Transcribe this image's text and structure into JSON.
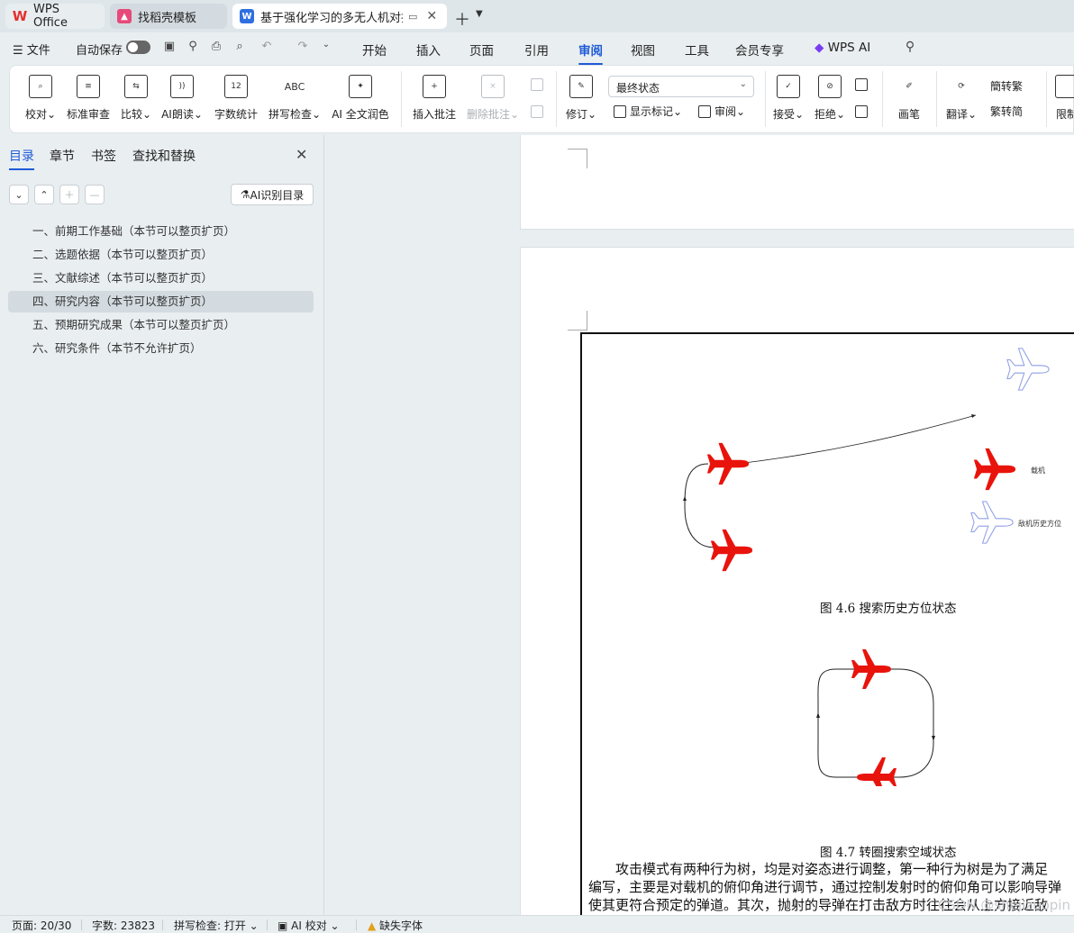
{
  "tabs": {
    "wps": "WPS Office",
    "templates": "找稻壳模板",
    "document": "基于强化学习的多无人机对抗"
  },
  "menu": {
    "file": "文件",
    "autosave": "自动保存",
    "tabs": [
      "开始",
      "插入",
      "页面",
      "引用",
      "审阅",
      "视图",
      "工具",
      "会员专享"
    ],
    "active_tab": "审阅",
    "wps_ai": "WPS AI"
  },
  "ribbon": {
    "proofread": "校对",
    "standard_review": "标准审查",
    "compare": "比较",
    "ai_read": "AI朗读",
    "word_count": "字数统计",
    "spell_check": "拼写检查",
    "ai_polish": "AI 全文润色",
    "insert_comment": "插入批注",
    "delete_comment": "删除批注",
    "revise": "修订",
    "final_state": "最终状态",
    "show_markup": "显示标记",
    "review": "审阅",
    "accept": "接受",
    "reject": "拒绝",
    "pen": "画笔",
    "translate": "翻译",
    "trad_conv": "转繁",
    "simp_conv": "转简",
    "restrict": "限制",
    "abc": "ABC",
    "num12": "12"
  },
  "sidebar": {
    "tabs": [
      "目录",
      "章节",
      "书签",
      "查找和替换"
    ],
    "active_tab": "目录",
    "ai_toc": "AI识别目录",
    "toc_items": [
      "一、前期工作基础（本节可以整页扩页）",
      "二、选题依据（本节可以整页扩页）",
      "三、文献综述（本节可以整页扩页）",
      "四、研究内容（本节可以整页扩页）",
      "五、预期研究成果（本节可以整页扩页）",
      "六、研究条件（本节不允许扩页）"
    ],
    "selected_index": 3
  },
  "document": {
    "legend_own": "载机",
    "legend_enemy": "敌机历史方位",
    "caption_1": "图 4.6  搜索历史方位状态",
    "caption_2": "图 4.7  转圈搜索空域状态",
    "body_lines": [
      "攻击模式有两种行为树，均是对姿态进行调整，第一种行为树是为了满足",
      "编写，主要是对载机的俯仰角进行调节，通过控制发射时的俯仰角可以影响导弹",
      "使其更符合预定的弹道。其次，抛射的导弹在打击敌方时往往会从上方接近敌"
    ],
    "watermark": "CSDN @shejizuopin"
  },
  "status": {
    "page": "页面: 20/30",
    "words": "字数: 23823",
    "spell": "拼写检查: 打开",
    "ai_proof": "AI 校对",
    "missing_font": "缺失字体"
  },
  "colors": {
    "accent": "#1f5bd6",
    "own_aircraft": "#e8140c",
    "enemy_aircraft": "#8f9fe6"
  }
}
